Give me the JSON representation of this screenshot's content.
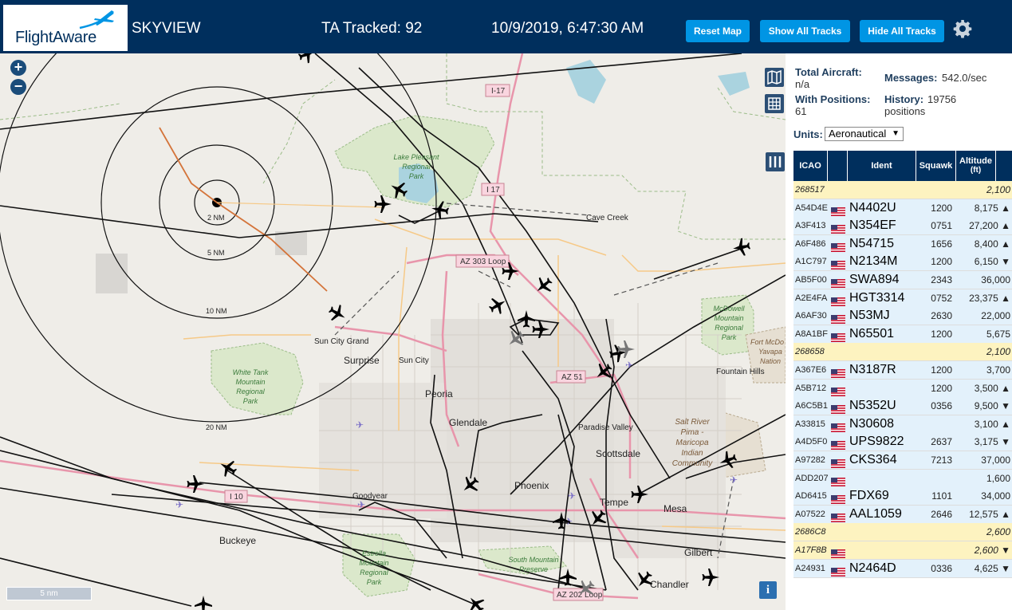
{
  "header": {
    "logo_text": "FlightAware",
    "title": "SKYVIEW",
    "tracked": "TA Tracked: 92",
    "datetime": "10/9/2019, 6:47:30 AM",
    "buttons": {
      "reset_map": "Reset Map",
      "show_all_tracks": "Show All Tracks",
      "hide_all_tracks": "Hide All Tracks"
    },
    "settings_icon": "gear-icon",
    "bg_color": "#002f5d",
    "button_color": "#0095e4"
  },
  "map": {
    "zoom_in": "+",
    "zoom_out": "−",
    "scale_label": "5 nm",
    "info_label": "i",
    "rings": [
      "2 NM",
      "5 NM",
      "10 NM",
      "20 NM"
    ],
    "roads": [
      "I-17",
      "I 17",
      "AZ 303 Loop",
      "AZ 51",
      "I 10",
      "AZ 202 Loop"
    ],
    "parks": {
      "lake_pleasant": [
        "Lake Pleasant",
        "Regional",
        "Park"
      ],
      "white_tank": [
        "White Tank",
        "Mountain",
        "Regional",
        "Park"
      ],
      "mcdowell": [
        "McDowell",
        "Mountain",
        "Regional",
        "Park"
      ],
      "estrella": [
        "Estrella",
        "Mountain",
        "Regional",
        "Park"
      ],
      "south_mountain": [
        "South Mountain",
        "Preserve"
      ],
      "salt_river": [
        "Salt River",
        "Pima -",
        "Maricopa",
        "Indian",
        "Community"
      ],
      "fort_mcdowell": [
        "Fort McDo",
        "Yavapa",
        "Nation"
      ]
    },
    "cities": {
      "cave_creek": "Cave Creek",
      "sun_city_grand": "Sun City Grand",
      "surprise": "Surprise",
      "sun_city": "Sun City",
      "peoria": "Peoria",
      "glendale": "Glendale",
      "fountain_hills": "Fountain Hills",
      "paradise_valley": "Paradise Valley",
      "scottsdale": "Scottsdale",
      "phoenix": "Phoenix",
      "tempe": "Tempe",
      "mesa": "Mesa",
      "goodyear": "Goodyear",
      "buckeye": "Buckeye",
      "gilbert": "Gilbert",
      "chandler": "Chandler"
    },
    "icons": [
      "map-icon",
      "grid-icon",
      "columns-icon",
      "airport-icon",
      "aircraft-icon"
    ]
  },
  "panel": {
    "total_aircraft_label": "Total Aircraft:",
    "total_aircraft_value": "n/a",
    "with_positions_label": "With Positions:",
    "with_positions_value": "61",
    "messages_label": "Messages:",
    "messages_value": "542.0/sec",
    "history_label": "History:",
    "history_value": "19756",
    "history_unit": "positions",
    "units_label": "Units:",
    "units_value": "Aeronautical"
  },
  "table": {
    "columns": {
      "icao": "ICAO",
      "ident": "Ident",
      "squawk": "Squawk",
      "altitude_1": "Altitude",
      "altitude_2": "(ft)"
    },
    "rows": [
      {
        "icao": "268517",
        "flag": "",
        "ident": "",
        "squawk": "",
        "alt": "2,100",
        "mlat": true
      },
      {
        "icao": "A54D4E",
        "flag": "us",
        "ident": "N4402U",
        "squawk": "1200",
        "alt": "8,175 ▲"
      },
      {
        "icao": "A3F413",
        "flag": "us",
        "ident": "N354EF",
        "squawk": "0751",
        "alt": "27,200 ▲"
      },
      {
        "icao": "A6F486",
        "flag": "us",
        "ident": "N54715",
        "squawk": "1656",
        "alt": "8,400 ▲"
      },
      {
        "icao": "A1C797",
        "flag": "us",
        "ident": "N2134M",
        "squawk": "1200",
        "alt": "6,150 ▼"
      },
      {
        "icao": "AB5F00",
        "flag": "us",
        "ident": "SWA894",
        "squawk": "2343",
        "alt": "36,000"
      },
      {
        "icao": "A2E4FA",
        "flag": "us",
        "ident": "HGT3314",
        "squawk": "0752",
        "alt": "23,375 ▲"
      },
      {
        "icao": "A6AF30",
        "flag": "us",
        "ident": "N53MJ",
        "squawk": "2630",
        "alt": "22,000"
      },
      {
        "icao": "A8A1BF",
        "flag": "us",
        "ident": "N65501",
        "squawk": "1200",
        "alt": "5,675"
      },
      {
        "icao": "268658",
        "flag": "",
        "ident": "",
        "squawk": "",
        "alt": "2,100",
        "mlat": true
      },
      {
        "icao": "A367E6",
        "flag": "us",
        "ident": "N3187R",
        "squawk": "1200",
        "alt": "3,700"
      },
      {
        "icao": "A5B712",
        "flag": "us",
        "ident": "",
        "squawk": "1200",
        "alt": "3,500 ▲"
      },
      {
        "icao": "A6C5B1",
        "flag": "us",
        "ident": "N5352U",
        "squawk": "0356",
        "alt": "9,500 ▼"
      },
      {
        "icao": "A33815",
        "flag": "us",
        "ident": "N30608",
        "squawk": "",
        "alt": "3,100 ▲"
      },
      {
        "icao": "A4D5F0",
        "flag": "us",
        "ident": "UPS9822",
        "squawk": "2637",
        "alt": "3,175 ▼"
      },
      {
        "icao": "A97282",
        "flag": "us",
        "ident": "CKS364",
        "squawk": "7213",
        "alt": "37,000"
      },
      {
        "icao": "ADD207",
        "flag": "us",
        "ident": "",
        "squawk": "",
        "alt": "1,600"
      },
      {
        "icao": "AD6415",
        "flag": "us",
        "ident": "FDX69",
        "squawk": "1101",
        "alt": "34,000"
      },
      {
        "icao": "A07522",
        "flag": "us",
        "ident": "AAL1059",
        "squawk": "2646",
        "alt": "12,575 ▲"
      },
      {
        "icao": "2686C8",
        "flag": "",
        "ident": "",
        "squawk": "",
        "alt": "2,600",
        "mlat": true
      },
      {
        "icao": "A17F8B",
        "flag": "us",
        "ident": "",
        "squawk": "",
        "alt": "2,600 ▼",
        "mlat": true
      },
      {
        "icao": "A24931",
        "flag": "us",
        "ident": "N2464D",
        "squawk": "0336",
        "alt": "4,625 ▼"
      }
    ],
    "header_color": "#002f5d",
    "mlat_row_color": "#fdf3c0",
    "row_color": "#e3f1fb"
  }
}
